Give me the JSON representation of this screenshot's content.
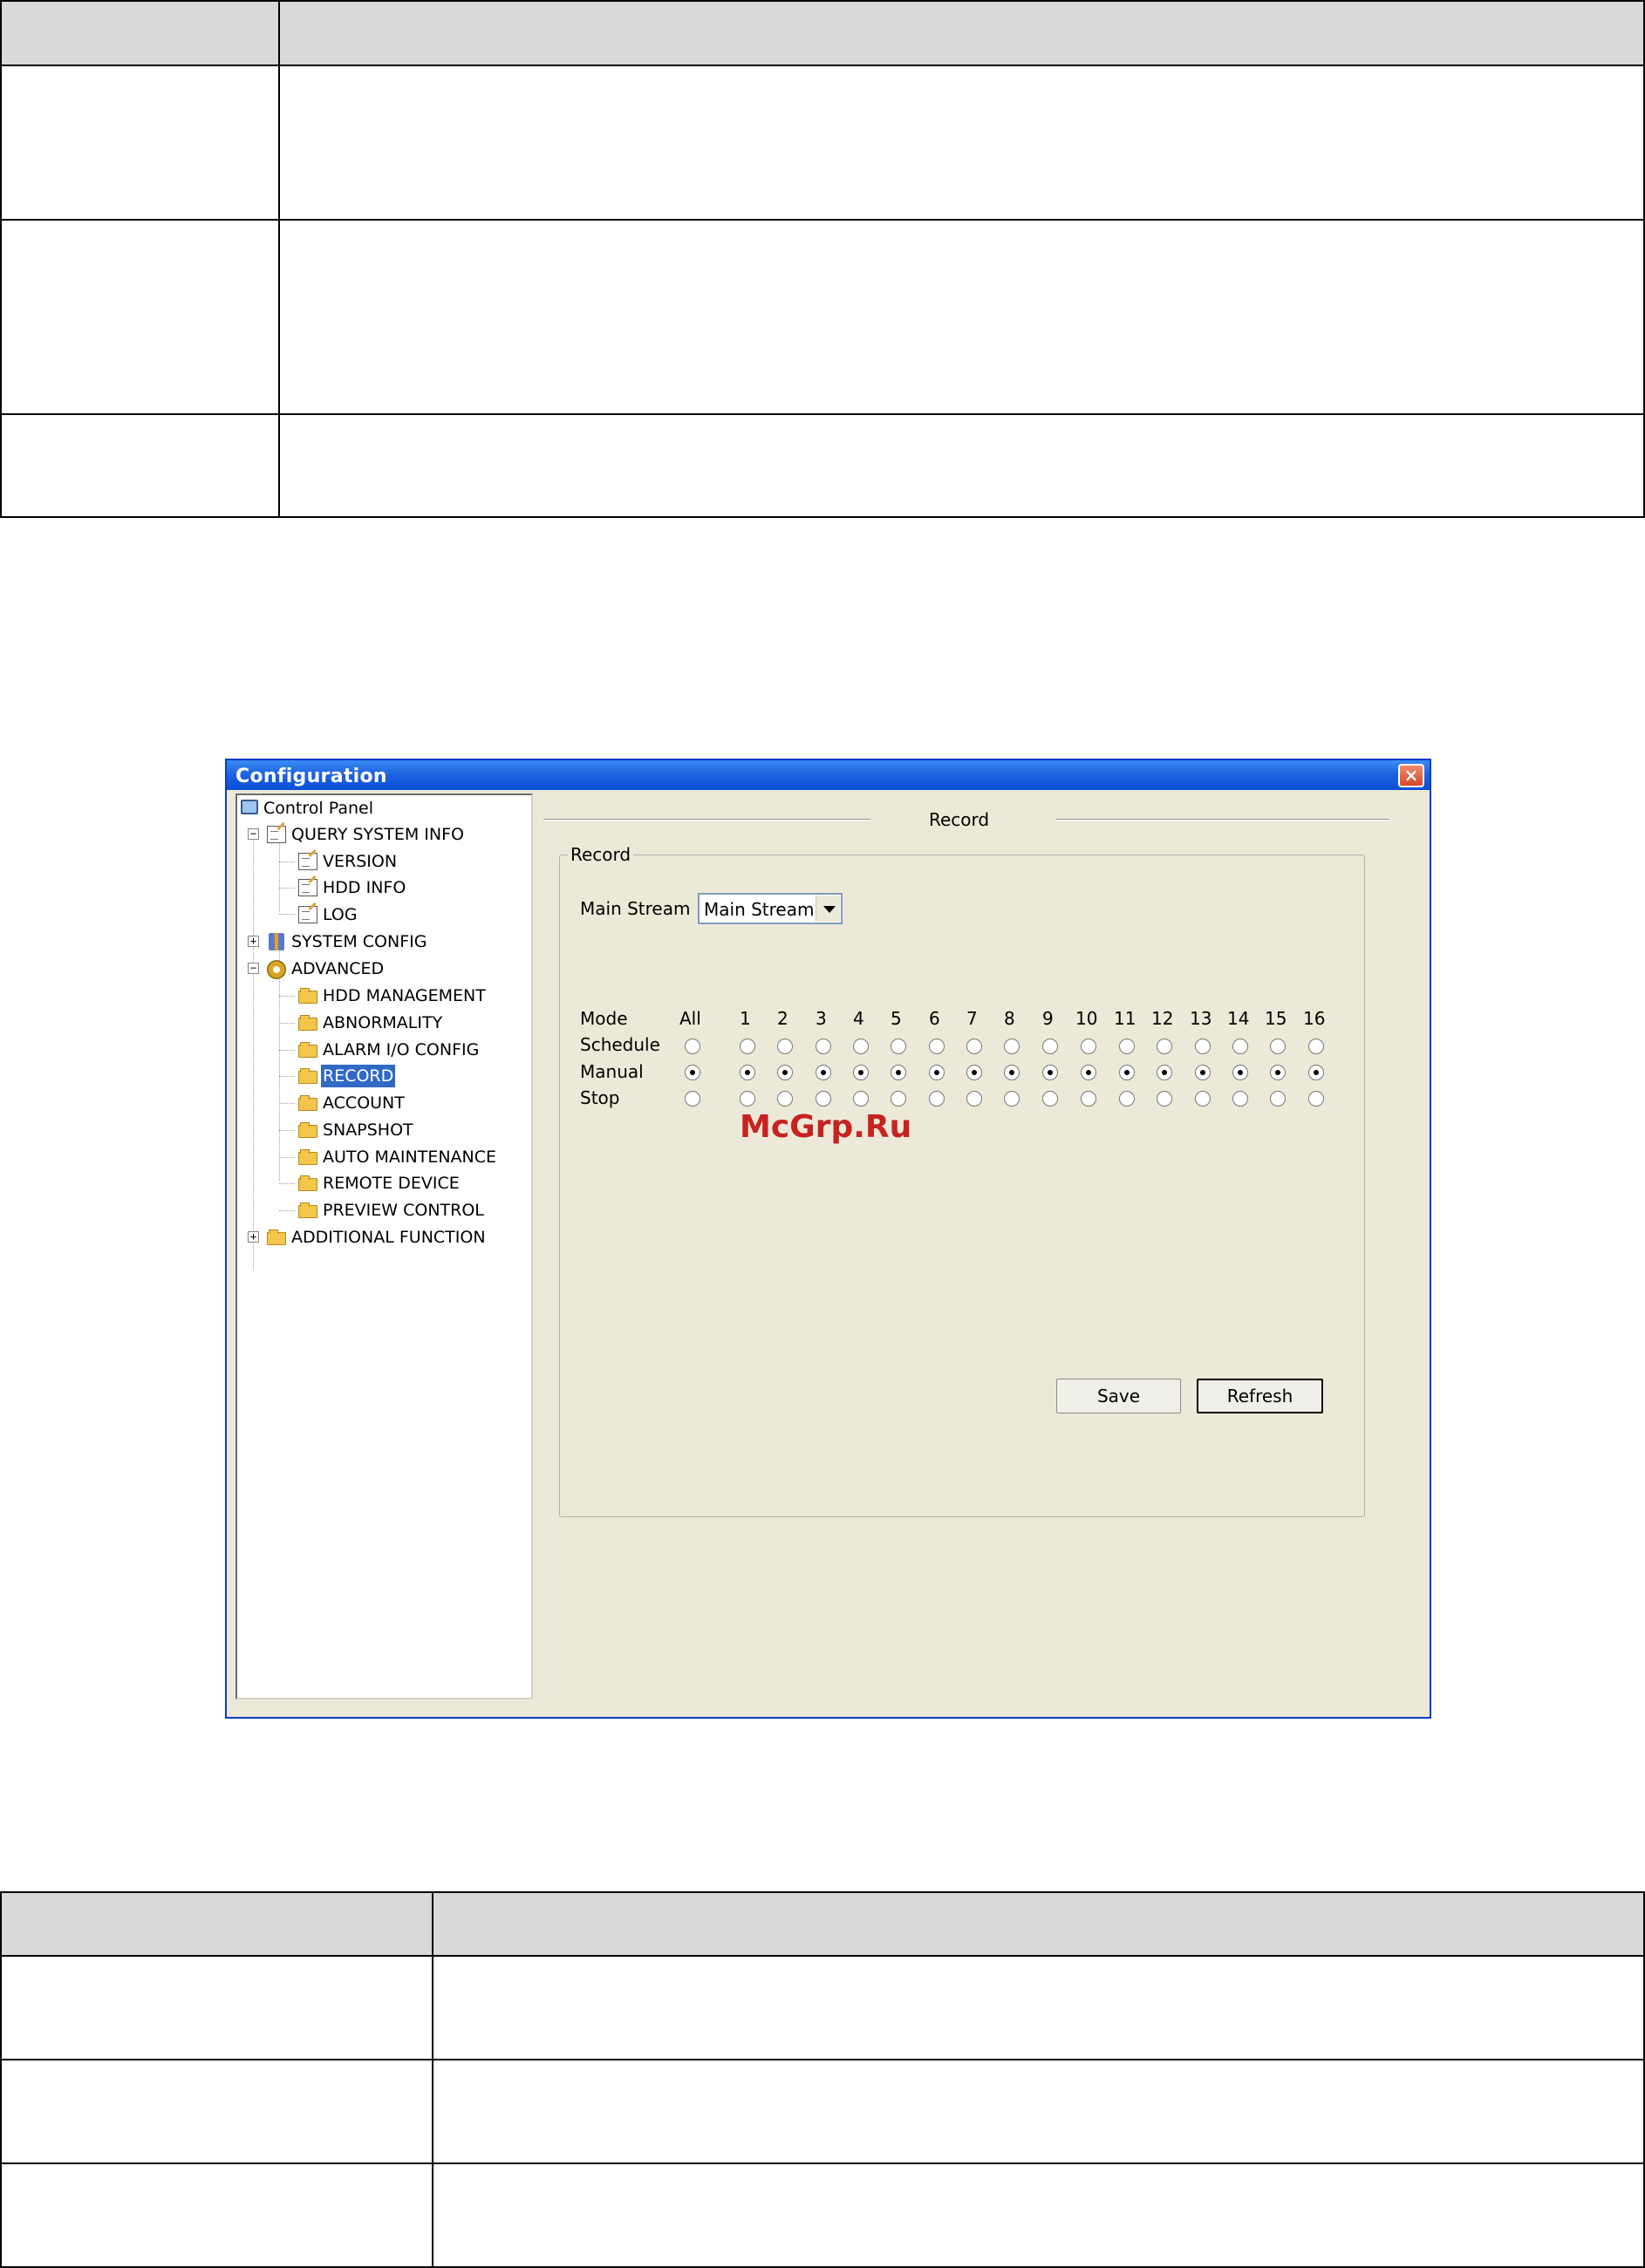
{
  "window": {
    "title": "Configuration",
    "close_label": "×"
  },
  "tree": {
    "root": "Control Panel",
    "query": "QUERY SYSTEM INFO",
    "query_children": [
      "VERSION",
      "HDD INFO",
      "LOG"
    ],
    "system_config": "SYSTEM CONFIG",
    "advanced": "ADVANCED",
    "advanced_children": [
      "HDD MANAGEMENT",
      "ABNORMALITY",
      "ALARM I/O CONFIG",
      "RECORD",
      "ACCOUNT",
      "SNAPSHOT",
      "AUTO MAINTENANCE",
      "REMOTE DEVICE",
      "PREVIEW CONTROL"
    ],
    "additional": "ADDITIONAL FUNCTION",
    "selected": "RECORD",
    "expand_plus": "+",
    "expand_minus": "−"
  },
  "panel": {
    "title": "Record",
    "group_label": "Record",
    "stream_label": "Main Stream",
    "stream_value": "Main Stream",
    "mode_label": "Mode",
    "all_label": "All",
    "channels": [
      "1",
      "2",
      "3",
      "4",
      "5",
      "6",
      "7",
      "8",
      "9",
      "10",
      "11",
      "12",
      "13",
      "14",
      "15",
      "16"
    ],
    "rows": [
      {
        "label": "Schedule",
        "checked": false
      },
      {
        "label": "Manual",
        "checked": true
      },
      {
        "label": "Stop",
        "checked": false
      }
    ],
    "save_label": "Save",
    "refresh_label": "Refresh"
  },
  "watermark": "McGrp.Ru",
  "colors": {
    "titlebar": "#1f63e0",
    "selection": "#316ac5",
    "table_header": "#d9d9d9",
    "close_button": "#d6452a"
  }
}
